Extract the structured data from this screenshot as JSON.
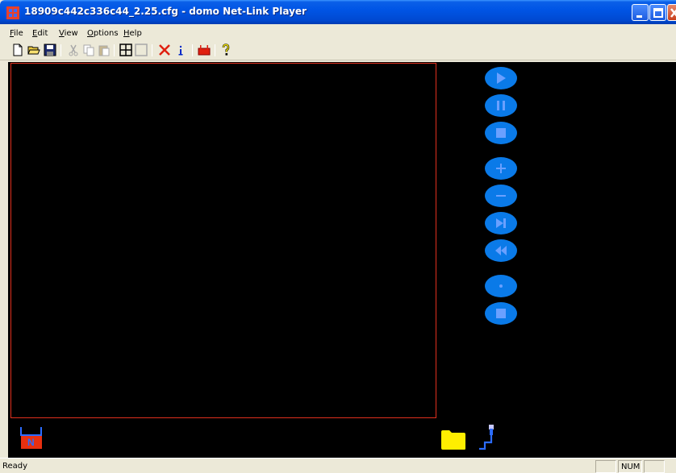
{
  "window": {
    "title": "18909c442c336c44_2.25.cfg - domo Net-Link Player"
  },
  "menu": [
    {
      "accel": "F",
      "rest": "ile"
    },
    {
      "accel": "E",
      "rest": "dit"
    },
    {
      "accel": "V",
      "rest": "iew"
    },
    {
      "accel": "O",
      "rest": "ptions"
    },
    {
      "accel": "H",
      "rest": "elp"
    }
  ],
  "toolbar": {
    "icons": [
      "new-file",
      "open-folder",
      "save",
      "cut",
      "copy",
      "paste",
      "grid",
      "blank",
      "delete",
      "info",
      "device",
      "help"
    ]
  },
  "controls": {
    "icons": [
      "play",
      "pause",
      "stop",
      "plus",
      "minus",
      "next",
      "rewind",
      "record-dot",
      "record-stop"
    ],
    "color": "#0a7ae8"
  },
  "bottom": {
    "device_badge": "N",
    "icons": [
      "device-n",
      "folder",
      "network-cable"
    ]
  },
  "status": {
    "text": "Ready",
    "num": "NUM"
  },
  "colors": {
    "titlebar": "#0055e5",
    "video_border": "#e0301e",
    "background": "#000000",
    "folder": "#ffee00"
  }
}
